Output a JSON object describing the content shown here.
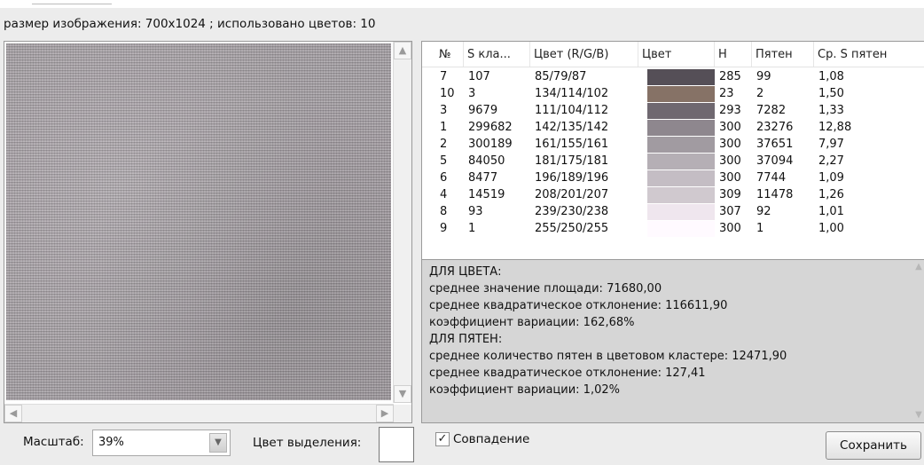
{
  "info_text": "размер изображения: 700x1024 ; использовано цветов: 10",
  "table": {
    "headers": [
      "№",
      "S кла...",
      "Цвет (R/G/B)",
      "Цвет",
      "H",
      "Пятен",
      "Ср. S пятен"
    ],
    "rows": [
      {
        "num": "7",
        "s": "107",
        "rgb": "85/79/87",
        "swatch": "#554f57",
        "h": "285",
        "spots": "99",
        "avg": "1,08"
      },
      {
        "num": "10",
        "s": "3",
        "rgb": "134/114/102",
        "swatch": "#867266",
        "h": "23",
        "spots": "2",
        "avg": "1,50"
      },
      {
        "num": "3",
        "s": "9679",
        "rgb": "111/104/112",
        "swatch": "#6f6870",
        "h": "293",
        "spots": "7282",
        "avg": "1,33"
      },
      {
        "num": "1",
        "s": "299682",
        "rgb": "142/135/142",
        "swatch": "#8e878e",
        "h": "300",
        "spots": "23276",
        "avg": "12,88"
      },
      {
        "num": "2",
        "s": "300189",
        "rgb": "161/155/161",
        "swatch": "#a19ba1",
        "h": "300",
        "spots": "37651",
        "avg": "7,97"
      },
      {
        "num": "5",
        "s": "84050",
        "rgb": "181/175/181",
        "swatch": "#b5afb5",
        "h": "300",
        "spots": "37094",
        "avg": "2,27"
      },
      {
        "num": "6",
        "s": "8477",
        "rgb": "196/189/196",
        "swatch": "#c4bdc4",
        "h": "300",
        "spots": "7744",
        "avg": "1,09"
      },
      {
        "num": "4",
        "s": "14519",
        "rgb": "208/201/207",
        "swatch": "#d0c9cf",
        "h": "309",
        "spots": "11478",
        "avg": "1,26"
      },
      {
        "num": "8",
        "s": "93",
        "rgb": "239/230/238",
        "swatch": "#efe6ee",
        "h": "307",
        "spots": "92",
        "avg": "1,01"
      },
      {
        "num": "9",
        "s": "1",
        "rgb": "255/250/255",
        "swatch": "#fffaff",
        "h": "300",
        "spots": "1",
        "avg": "1,00"
      }
    ]
  },
  "stats": [
    "ДЛЯ ЦВЕТА:",
    "среднее значение площади: 71680,00",
    "среднее квадратическое отклонение: 116611,90",
    "коэффициент вариации: 162,68%",
    "ДЛЯ ПЯТЕН:",
    "среднее количество пятен в цветовом кластере: 12471,90",
    "среднее квадратическое отклонение: 127,41",
    "коэффициент вариации: 1,02%"
  ],
  "bottom": {
    "scale_label": "Масштаб:",
    "scale_value": "39%",
    "highlight_label": "Цвет выделения:",
    "highlight_color": "#ffffff",
    "match_label": "Совпадение",
    "match_checked": true,
    "save_label": "Сохранить"
  },
  "icons": {
    "scroll_up": "chevron-up-icon",
    "scroll_down": "chevron-down-icon",
    "scroll_left": "chevron-left-icon",
    "scroll_right": "chevron-right-icon",
    "dropdown": "chevron-down-icon",
    "checkbox": "check-icon"
  }
}
